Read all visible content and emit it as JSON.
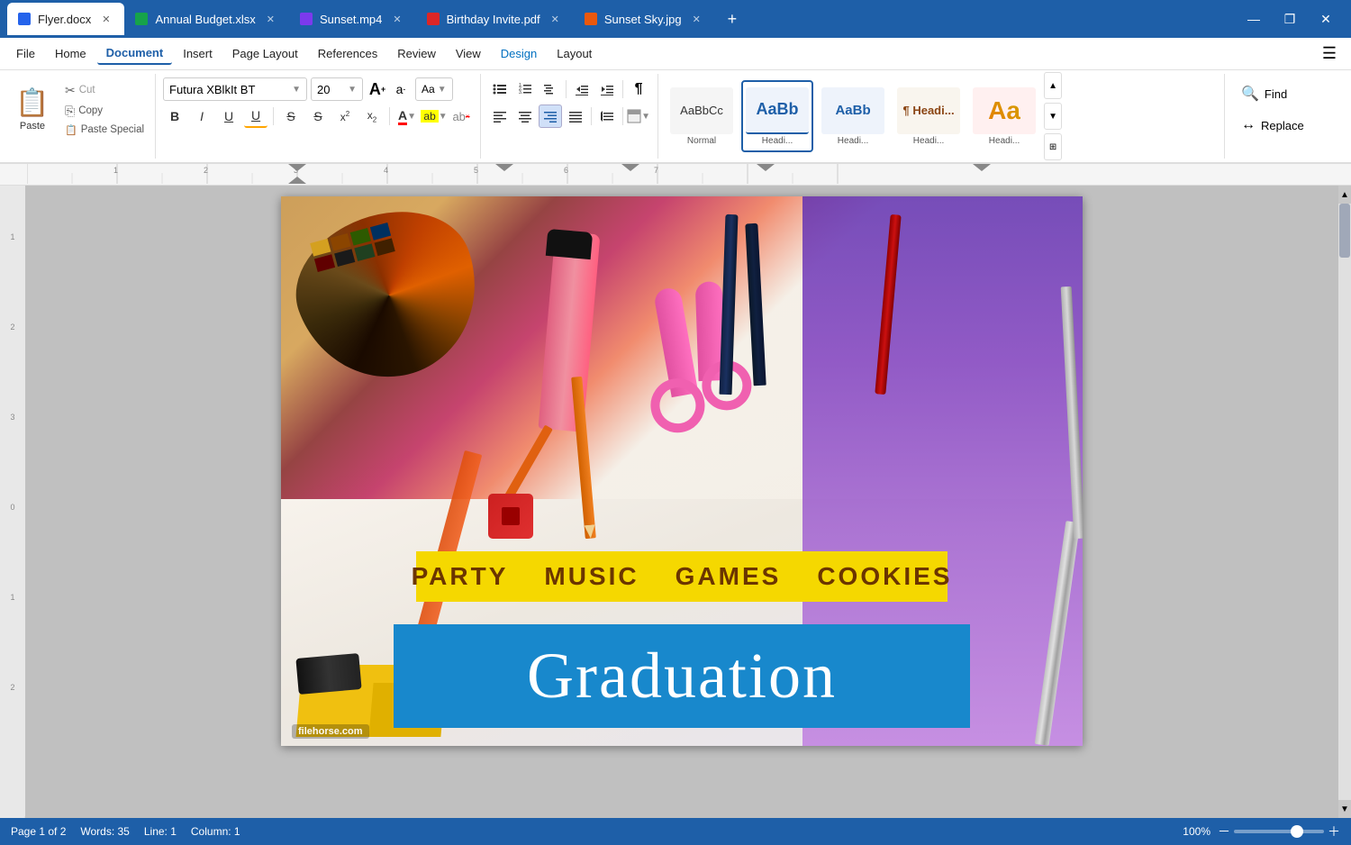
{
  "titlebar": {
    "tabs": [
      {
        "id": "flyer",
        "label": "Flyer.docx",
        "color": "dot-blue",
        "active": true
      },
      {
        "id": "budget",
        "label": "Annual Budget.xlsx",
        "color": "dot-green",
        "active": false
      },
      {
        "id": "sunset",
        "label": "Sunset.mp4",
        "color": "dot-purple",
        "active": false
      },
      {
        "id": "birthday",
        "label": "Birthday Invite.pdf",
        "color": "dot-red",
        "active": false
      },
      {
        "id": "sunsetsky",
        "label": "Sunset Sky.jpg",
        "color": "dot-orange",
        "active": false
      }
    ],
    "add_tab_label": "+",
    "win_minimize": "—",
    "win_restore": "❐",
    "win_close": "✕"
  },
  "menubar": {
    "items": [
      {
        "id": "file",
        "label": "File"
      },
      {
        "id": "home",
        "label": "Home"
      },
      {
        "id": "document",
        "label": "Document",
        "active": true
      },
      {
        "id": "insert",
        "label": "Insert"
      },
      {
        "id": "pagelayout",
        "label": "Page Layout"
      },
      {
        "id": "references",
        "label": "References"
      },
      {
        "id": "review",
        "label": "Review"
      },
      {
        "id": "view",
        "label": "View"
      },
      {
        "id": "design",
        "label": "Design",
        "highlight": true
      },
      {
        "id": "layout",
        "label": "Layout"
      }
    ]
  },
  "ribbon": {
    "paste_group": {
      "paste_label": "Paste",
      "cut_label": "Cut",
      "copy_label": "Copy",
      "paste_special_label": "Paste Special"
    },
    "font_group": {
      "font_name": "Futura XBlkIt BT",
      "font_size": "20",
      "font_size_up_label": "A",
      "font_size_down_label": "a",
      "aa_label": "Aa",
      "bold_label": "B",
      "italic_label": "I",
      "underline_label": "U",
      "underline2_label": "U",
      "strike_label": "S",
      "strike2_label": "S",
      "super_label": "x²",
      "sub_label": "x₂",
      "font_color_label": "A",
      "highlight_label": "ab"
    },
    "paragraph_group": {
      "bullets_label": "≡",
      "numbering_label": "≡",
      "multilevel_label": "≡",
      "decrease_indent_label": "⇤",
      "increase_indent_label": "⇥",
      "show_hide_label": "¶",
      "align_left_label": "≡",
      "align_center_label": "≡",
      "align_right_active_label": "≡",
      "justify_label": "≡",
      "line_spacing_label": "≡",
      "shading_label": "▭"
    },
    "styles": [
      {
        "id": "normal",
        "label": "Normal",
        "preview_text": "AaBbCc"
      },
      {
        "id": "heading1",
        "label": "Headi...",
        "preview_text": "AaBb",
        "active": true
      },
      {
        "id": "heading2",
        "label": "Headi...",
        "preview_text": "AaBb"
      },
      {
        "id": "heading3",
        "label": "Headi...",
        "preview_text": "¶ Headi..."
      },
      {
        "id": "heading4",
        "label": "Headi...",
        "preview_text": "Aa",
        "special": true
      }
    ],
    "find_replace": {
      "find_label": "Find",
      "replace_label": "Replace",
      "find_icon": "🔍",
      "replace_icon": "↔"
    }
  },
  "document": {
    "party_items": [
      "PARTY",
      "MUSIC",
      "GAMES",
      "COOKIES"
    ],
    "graduation_text": "Graduation",
    "watermark": "filehorse.com"
  },
  "statusbar": {
    "page_info": "Page 1 of 2",
    "words": "Words: 35",
    "line": "Line: 1",
    "column": "Column: 1",
    "zoom": "100%",
    "zoom_value": 100
  }
}
